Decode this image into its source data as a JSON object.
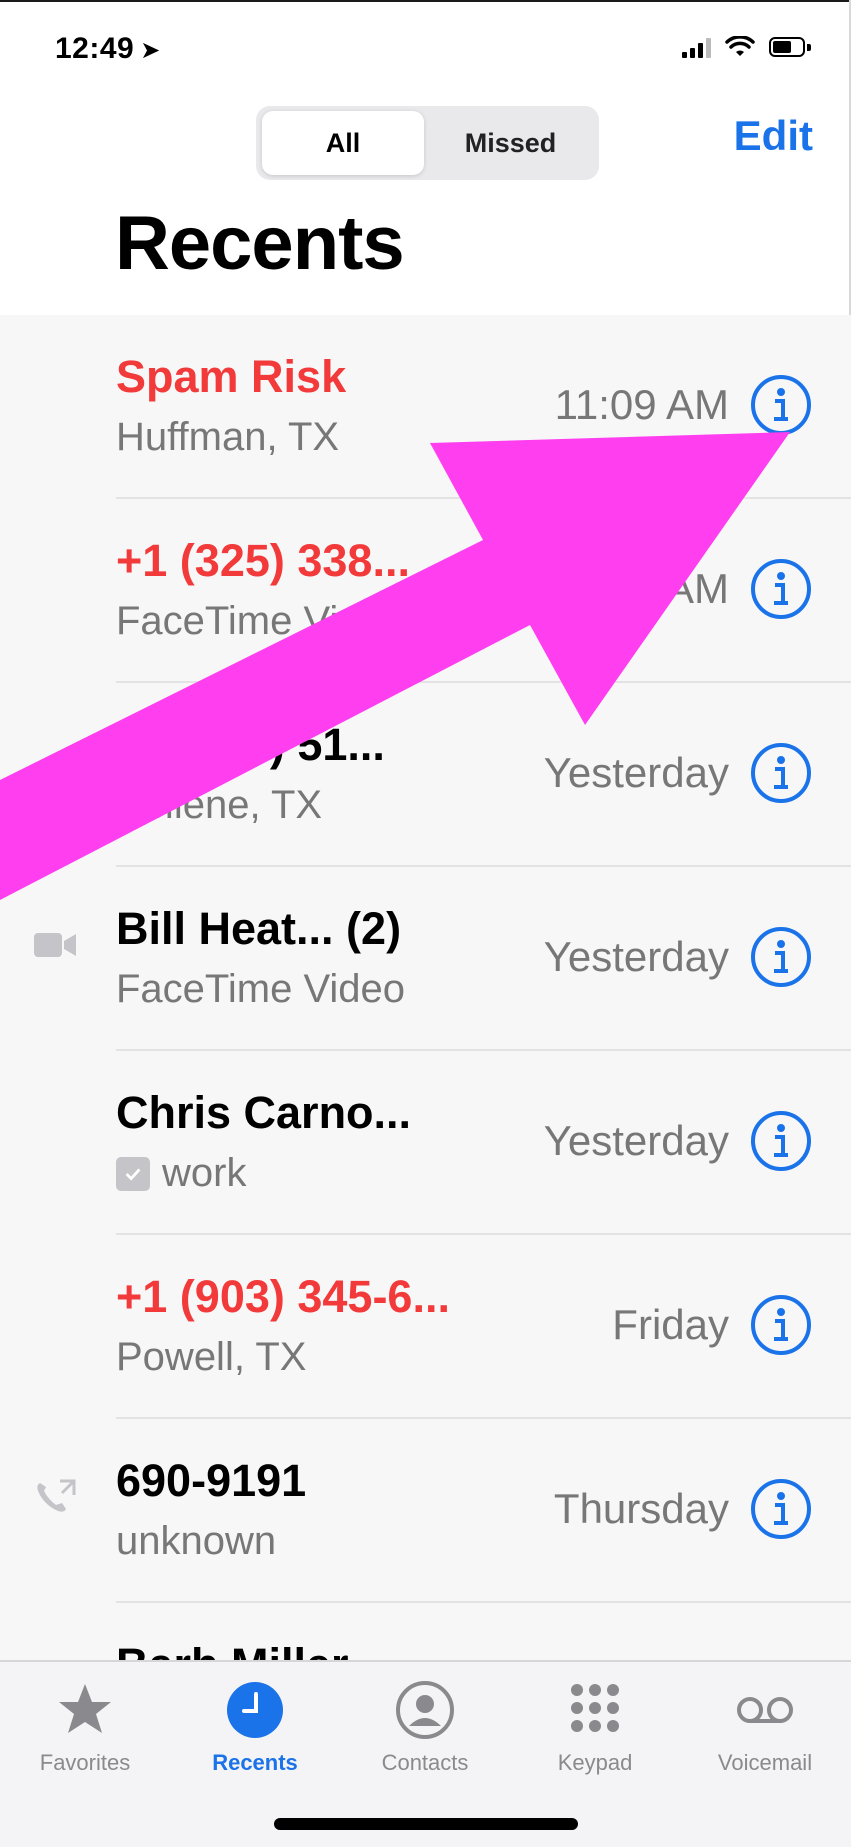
{
  "status_bar": {
    "time": "12:49",
    "location_glyph": "➤"
  },
  "segmented": {
    "all_label": "All",
    "missed_label": "Missed",
    "selected": "All"
  },
  "header": {
    "edit_label": "Edit",
    "title": "Recents"
  },
  "calls": [
    {
      "name": "Spam Risk",
      "subtitle": "Huffman, TX",
      "time": "11:09 AM",
      "missed": true,
      "type_icon": null
    },
    {
      "name": "+1 (325) 338...",
      "subtitle": "FaceTime Video",
      "time": "AM",
      "missed": true,
      "type_icon": null
    },
    {
      "name": "+1 (325) 51...",
      "subtitle": "Abilene, TX",
      "time": "Yesterday",
      "missed": false,
      "type_icon": null
    },
    {
      "name": "Bill Heat...   (2)",
      "subtitle": "FaceTime Video",
      "time": "Yesterday",
      "missed": false,
      "type_icon": "video-camera-icon"
    },
    {
      "name": "Chris Carno...",
      "subtitle": "work",
      "time": "Yesterday",
      "missed": false,
      "type_icon": null,
      "subtitle_icon": "checkbox-icon"
    },
    {
      "name": "+1 (903) 345-6...",
      "subtitle": "Powell, TX",
      "time": "Friday",
      "missed": true,
      "type_icon": null
    },
    {
      "name": "690-9191",
      "subtitle": "unknown",
      "time": "Thursday",
      "missed": false,
      "type_icon": "outgoing-call-icon"
    },
    {
      "name": "Barb Miller",
      "subtitle": "",
      "time": "",
      "missed": false,
      "type_icon": "outgoing-call-icon"
    }
  ],
  "tab_bar": {
    "tabs": [
      {
        "label": "Favorites",
        "icon": "star-icon"
      },
      {
        "label": "Recents",
        "icon": "clock-icon",
        "active": true
      },
      {
        "label": "Contacts",
        "icon": "person-circle-icon"
      },
      {
        "label": "Keypad",
        "icon": "keypad-icon"
      },
      {
        "label": "Voicemail",
        "icon": "voicemail-icon"
      }
    ]
  },
  "colors": {
    "accent": "#1a73e8",
    "missed": "#f23a3a",
    "annotation": "#ff3ef0"
  }
}
